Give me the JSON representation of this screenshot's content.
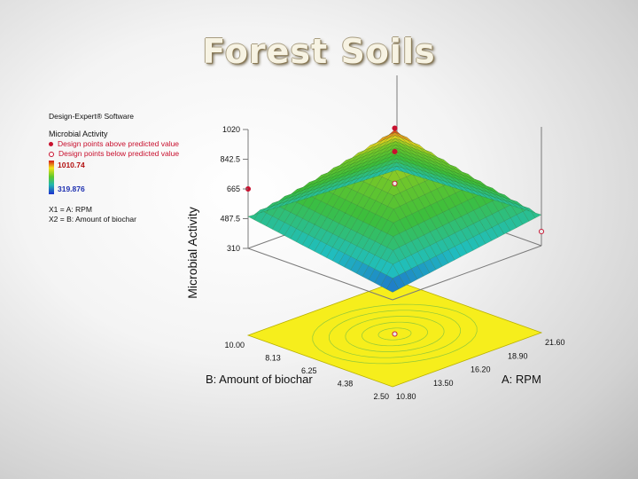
{
  "slide": {
    "title": "Forest Soils"
  },
  "legend": {
    "software": "Design-Expert® Software",
    "response": "Microbial Activity",
    "above_label": "Design points above predicted value",
    "below_label": "Design points below predicted value",
    "max": "1010.74",
    "min": "319.876",
    "x1": "X1 = A: RPM",
    "x2": "X2 = B: Amount of biochar"
  },
  "colors": {
    "above": "#c8102e",
    "below": "#e8e8e8",
    "contour_plane": "#f6ee1c"
  },
  "chart_data": {
    "type": "surface3d",
    "zlabel": "Microbial Activity",
    "xlabel": "A: RPM",
    "ylabel": "B: Amount of biochar",
    "z_ticks": [
      "310",
      "487.5",
      "665",
      "842.5",
      "1020"
    ],
    "a_ticks": [
      "10.80",
      "13.50",
      "16.20",
      "18.90",
      "21.60"
    ],
    "b_ticks": [
      "2.50",
      "4.38",
      "6.25",
      "8.13",
      "10.00"
    ],
    "a_range": [
      10.8,
      21.6
    ],
    "b_range": [
      2.5,
      10.0
    ],
    "z_range": [
      310,
      1020
    ],
    "surface_corners": [
      {
        "a": 10.8,
        "b": 2.5,
        "z": 355
      },
      {
        "a": 21.6,
        "b": 2.5,
        "z": 495
      },
      {
        "a": 10.8,
        "b": 10.0,
        "z": 500
      },
      {
        "a": 21.6,
        "b": 10.0,
        "z": 455
      }
    ],
    "surface_center": {
      "a": 16.2,
      "b": 6.25,
      "z": 1010.74
    },
    "design_points": [
      {
        "a": 16.2,
        "b": 6.25,
        "z": 1020,
        "type": "above"
      },
      {
        "a": 16.2,
        "b": 6.25,
        "z": 880,
        "type": "above"
      },
      {
        "a": 16.2,
        "b": 6.25,
        "z": 690,
        "type": "below"
      },
      {
        "a": 10.8,
        "b": 10.0,
        "z": 665,
        "type": "above"
      },
      {
        "a": 21.6,
        "b": 2.5,
        "z": 395,
        "type": "below"
      },
      {
        "a": 16.2,
        "b": 6.25,
        "z": 310,
        "type": "below"
      }
    ]
  }
}
